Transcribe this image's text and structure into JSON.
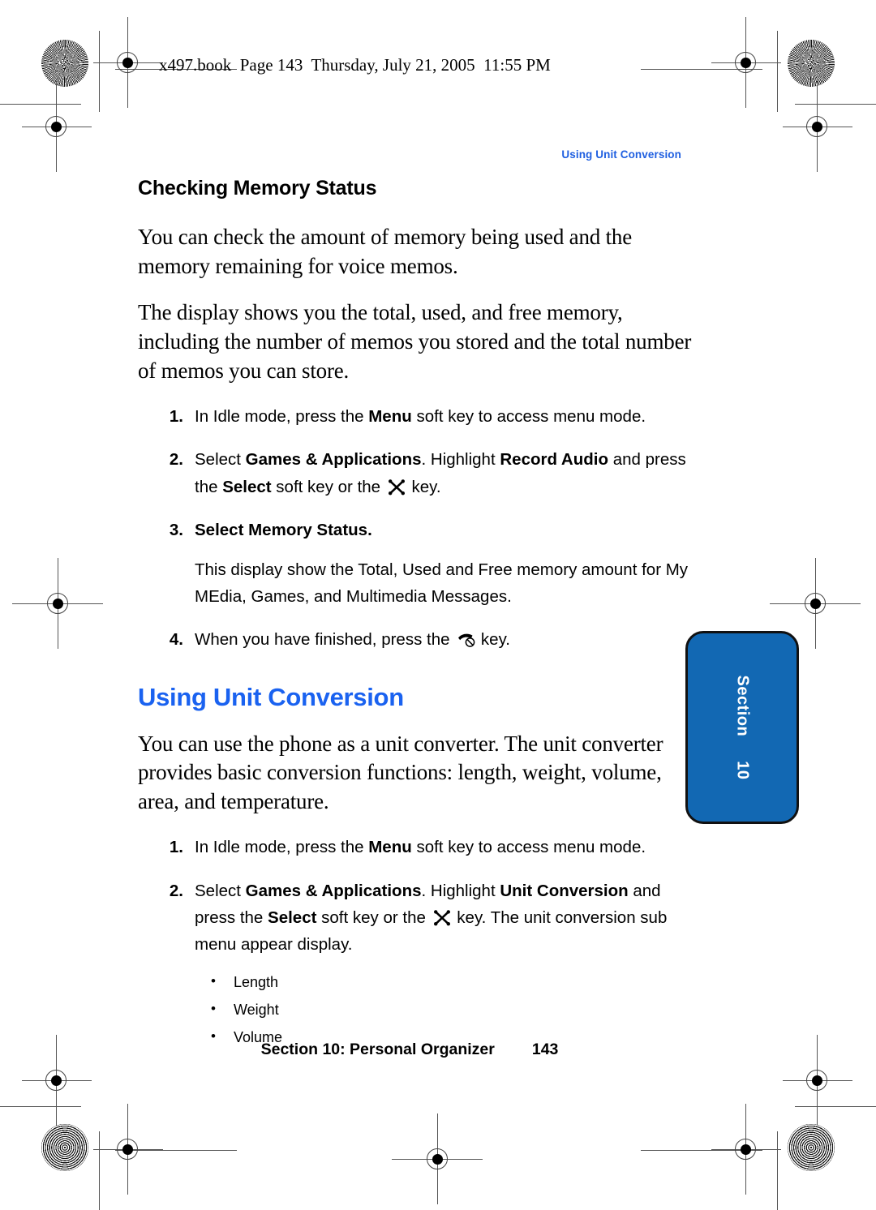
{
  "print_header": {
    "text": "x497.book  Page 143  Thursday, July 21, 2005  11:55 PM"
  },
  "running_header": {
    "text": "Using Unit Conversion"
  },
  "colors": {
    "heading_blue": "#1a62f0",
    "running_header_blue": "#1f5fe0",
    "tab_blue": "#1268b3",
    "text_black": "#000000"
  },
  "sections": {
    "memory_status": {
      "heading": "Checking Memory Status",
      "paragraphs": [
        "You can check the amount of memory being used and the memory remaining for voice memos.",
        "The display shows you the total, used, and free memory, including the number of memos you stored and the total number of memos you can store."
      ],
      "steps": [
        {
          "num": "1.",
          "parts": [
            {
              "t": "In Idle mode, press the ",
              "b": false
            },
            {
              "t": "Menu",
              "b": true
            },
            {
              "t": " soft key to access menu mode.",
              "b": false
            }
          ]
        },
        {
          "num": "2.",
          "parts": [
            {
              "t": "Select ",
              "b": false
            },
            {
              "t": "Games & Applications",
              "b": true
            },
            {
              "t": ". Highlight ",
              "b": false
            },
            {
              "t": "Record Audio",
              "b": true
            },
            {
              "t": " and press the ",
              "b": false
            },
            {
              "t": "Select",
              "b": true
            },
            {
              "t": " soft key or the ",
              "b": false
            },
            {
              "icon": "ok-navigation-key-icon"
            },
            {
              "t": " key.",
              "b": false
            }
          ]
        },
        {
          "num": "3.",
          "parts": [
            {
              "t": "Select ",
              "b": true
            },
            {
              "t": "Memory Status",
              "b": true
            },
            {
              "t": ".",
              "b": true
            }
          ],
          "note": "This display show the Total, Used and Free memory amount for My MEdia, Games, and Multimedia Messages."
        },
        {
          "num": "4.",
          "parts": [
            {
              "t": "When you have finished, press the ",
              "b": false
            },
            {
              "icon": "end-call-key-icon"
            },
            {
              "t": " key.",
              "b": false
            }
          ]
        }
      ]
    },
    "unit_conversion": {
      "heading": "Using Unit Conversion",
      "paragraphs": [
        "You can use the phone as a unit converter. The unit converter provides basic conversion functions: length, weight, volume, area, and temperature."
      ],
      "steps": [
        {
          "num": "1.",
          "parts": [
            {
              "t": "In Idle mode, press the ",
              "b": false
            },
            {
              "t": "Menu",
              "b": true
            },
            {
              "t": " soft key to access menu mode.",
              "b": false
            }
          ]
        },
        {
          "num": "2.",
          "parts": [
            {
              "t": "Select ",
              "b": false
            },
            {
              "t": "Games & Applications",
              "b": true
            },
            {
              "t": ". Highlight ",
              "b": false
            },
            {
              "t": "Unit Conversion",
              "b": true
            },
            {
              "t": " and press the ",
              "b": false
            },
            {
              "t": "Select",
              "b": true
            },
            {
              "t": " soft key or the ",
              "b": false
            },
            {
              "icon": "ok-navigation-key-icon"
            },
            {
              "t": " key. The unit conversion sub menu appear display.",
              "b": false
            }
          ]
        }
      ],
      "bullets": [
        "Length",
        "Weight",
        "Volume"
      ]
    }
  },
  "section_tab": {
    "label": "Section",
    "number": "10"
  },
  "footer": {
    "title": "Section 10: Personal Organizer",
    "page_number": "143"
  }
}
